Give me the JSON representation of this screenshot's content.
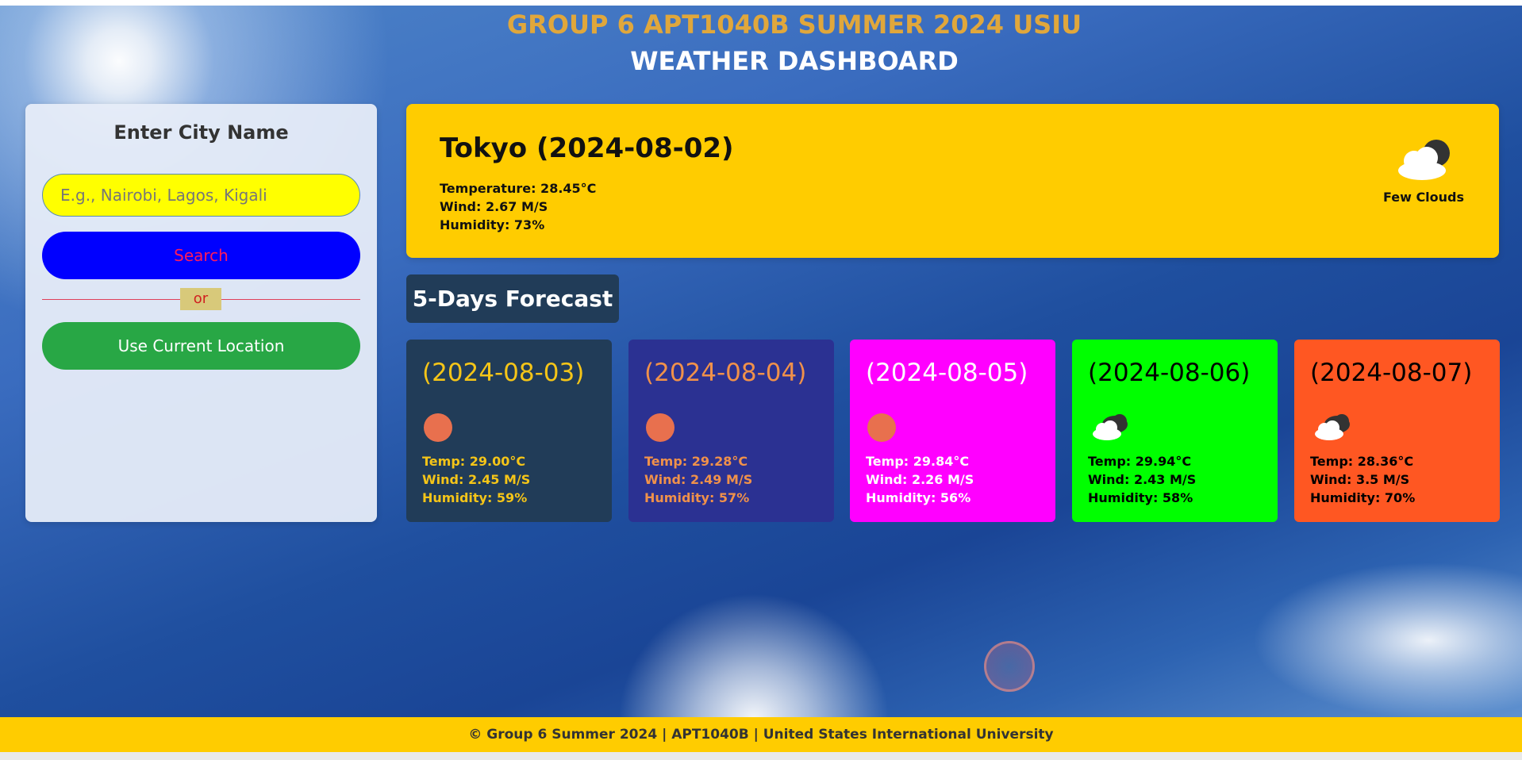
{
  "header": {
    "line1": "GROUP 6 APT1040B SUMMER 2024 USIU",
    "line2": "WEATHER DASHBOARD"
  },
  "search_panel": {
    "title": "Enter City Name",
    "input_placeholder": "E.g., Nairobi, Lagos, Kigali",
    "input_value": "",
    "search_label": "Search",
    "or_label": "or",
    "location_label": "Use Current Location"
  },
  "current": {
    "title": "Tokyo (2024-08-02)",
    "temperature": "Temperature: 28.45°C",
    "wind": "Wind: 2.67 M/S",
    "humidity": "Humidity: 73%",
    "description": "Few Clouds",
    "icon": "few-clouds-icon"
  },
  "forecast": {
    "heading": "5-Days Forecast",
    "days": [
      {
        "date": "(2024-08-03)",
        "temp": "Temp: 29.00°C",
        "wind": "Wind: 2.45 M/S",
        "humidity": "Humidity: 59%",
        "icon": "sun-icon",
        "bg": "#213c58",
        "color": "#f5c518"
      },
      {
        "date": "(2024-08-04)",
        "temp": "Temp: 29.28°C",
        "wind": "Wind: 2.49 M/S",
        "humidity": "Humidity: 57%",
        "icon": "sun-icon",
        "bg": "#2b3192",
        "color": "#f0914a"
      },
      {
        "date": "(2024-08-05)",
        "temp": "Temp: 29.84°C",
        "wind": "Wind: 2.26 M/S",
        "humidity": "Humidity: 56%",
        "icon": "sun-icon",
        "bg": "#ff00ff",
        "color": "#ffffff"
      },
      {
        "date": "(2024-08-06)",
        "temp": "Temp: 29.94°C",
        "wind": "Wind: 2.43 M/S",
        "humidity": "Humidity: 58%",
        "icon": "broken-clouds-icon",
        "bg": "#00ff00",
        "color": "#000000"
      },
      {
        "date": "(2024-08-07)",
        "temp": "Temp: 28.36°C",
        "wind": "Wind: 3.5 M/S",
        "humidity": "Humidity: 70%",
        "icon": "broken-clouds-icon",
        "bg": "#ff5722",
        "color": "#000000"
      }
    ]
  },
  "footer": {
    "text": "© Group 6 Summer 2024 | APT1040B | United States International University"
  },
  "colors": {
    "accent_yellow": "#ffcc00",
    "header_gold": "#e0a73c",
    "search_blue": "#0000ff",
    "location_green": "#28a745",
    "sun": "#e8704e"
  }
}
